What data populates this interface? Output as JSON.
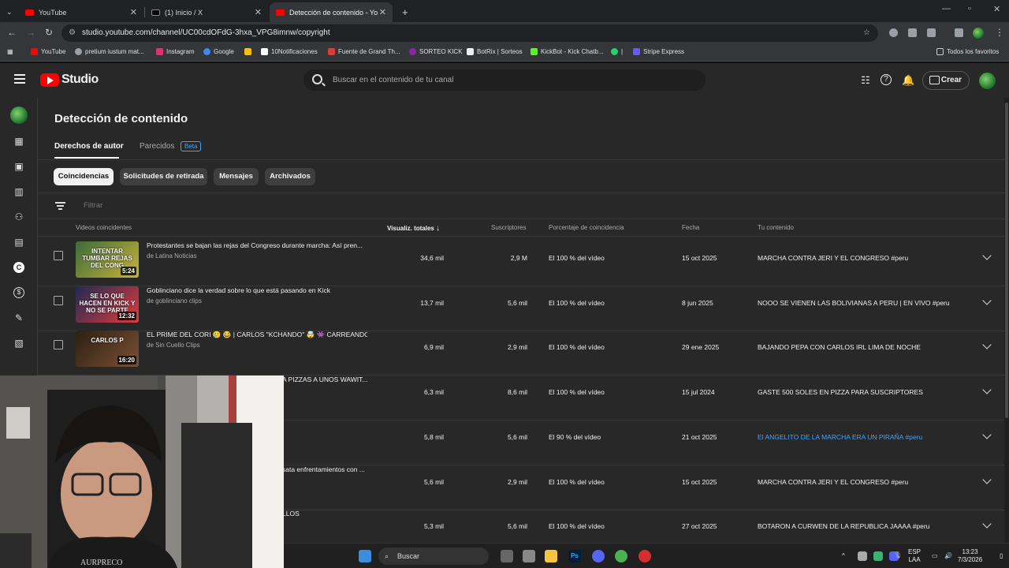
{
  "browser": {
    "tabs": [
      {
        "label": "YouTube"
      },
      {
        "label": "(1) Inicio / X"
      },
      {
        "label": "Detección de contenido - YouT"
      }
    ],
    "new_tab": "+",
    "url": "studio.youtube.com/channel/UC00cdOFdG-3hxa_VPG8imnw/copyright",
    "bookmarks": [
      {
        "label": "YouTube",
        "color": "#ff0000"
      },
      {
        "label": "pretium iustum mat...",
        "color": "#9aa0a6"
      },
      {
        "label": "Instagram",
        "color": "#e1306c"
      },
      {
        "label": "Google",
        "color": "#4285f4"
      },
      {
        "label": "",
        "color": "#fbbc04"
      },
      {
        "label": "10Notificaciones",
        "color": "#ffffff"
      },
      {
        "label": "Fuente de Grand Th...",
        "color": "#e53935"
      },
      {
        "label": "SORTEO KICK",
        "color": "#8e24aa"
      },
      {
        "label": "BotRix | Sorteos",
        "color": "#eeeeee"
      },
      {
        "label": "KickBot - Kick Chatb...",
        "color": "#53fc18"
      },
      {
        "label": "|",
        "color": "#25d366"
      },
      {
        "label": "Stripe Express",
        "color": "#635bff"
      }
    ],
    "all_bookmarks": "Todos los favoritos"
  },
  "studio": {
    "logo_text": "Studio",
    "search_placeholder": "Buscar en el contenido de tu canal",
    "create_label": "Crear"
  },
  "page": {
    "title": "Detección de contenido",
    "tabs": [
      {
        "label": "Derechos de autor"
      },
      {
        "label": "Parecidos"
      }
    ],
    "beta_badge": "Beta",
    "chips": [
      {
        "label": "Coincidencias"
      },
      {
        "label": "Solicitudes de retirada"
      },
      {
        "label": "Mensajes"
      },
      {
        "label": "Archivados"
      }
    ],
    "filter_placeholder": "Filtrar",
    "columns": {
      "videos": "Videos coincidentes",
      "views": "Visualiz. totales",
      "subs": "Suscriptores",
      "percent": "Porcentaje de coincidencia",
      "date": "Fecha",
      "content": "Tu contenido"
    },
    "rows": [
      {
        "title": "Protestantes se bajan las rejas del Congreso durante marcha: Así pren...",
        "channel": "de Latina Noticias",
        "thumb_caption": "INTENTAR TUMBAR REJAS DEL CONG",
        "duration": "5:24",
        "views": "34,6 mil",
        "subs": "2,9 M",
        "percent": "El 100 % del vídeo",
        "date": "15 oct 2025",
        "content": "MARCHA CONTRA JERI Y EL CONGRESO #peru",
        "link": false
      },
      {
        "title": "Goblinciano dice la verdad sobre lo que está pasando en Kick",
        "channel": "de goblinciano clips",
        "thumb_caption": "SE LO QUE HACEN EN KICK Y NO SE PARTE",
        "duration": "12:32",
        "views": "13,7 mil",
        "subs": "5,6 mil",
        "percent": "El 100 % del vídeo",
        "date": "8 jun 2025",
        "content": "NOOO SE VIENEN LAS BOLIVIANAS A PERU | EN VIVO #peru",
        "link": false
      },
      {
        "title": "EL PRIME DEL CORI 🥲 😂 | CARLOS \"KCHANDO\" 🤯 👾 CARREANDO E...",
        "channel": "de Sin Cuello Clips",
        "thumb_caption": "CARLOS P",
        "duration": "16:20",
        "views": "6,9 mil",
        "subs": "2,9 mil",
        "percent": "El 100 % del vídeo",
        "date": "29 ene 2025",
        "content": "BAJANDO PEPA CON CARLOS IRL LIMA DE NOCHE",
        "link": false
      },
      {
        "title": "A PIZZAS A UNOS WAWIT...",
        "channel": "",
        "thumb_caption": "",
        "duration": "",
        "views": "6,3 mil",
        "subs": "8,6 mil",
        "percent": "El 100 % del vídeo",
        "date": "15 jul 2024",
        "content": "GASTE 500 SOLES EN PIZZA PARA SUSCRIPTORES",
        "link": false
      },
      {
        "title": "",
        "channel": "",
        "thumb_caption": "",
        "duration": "",
        "views": "5,8 mil",
        "subs": "5,6 mil",
        "percent": "El 90 % del vídeo",
        "date": "21 oct 2025",
        "content": "El ANGELITO DE LA MARCHA ERA UN PIRAÑA #peru",
        "link": true
      },
      {
        "title": "sata enfrentamientos con ...",
        "channel": "",
        "thumb_caption": "",
        "duration": "",
        "views": "5,6 mil",
        "subs": "2,9 mil",
        "percent": "El 100 % del vídeo",
        "date": "15 oct 2025",
        "content": "MARCHA CONTRA JERI Y EL CONGRESO #peru",
        "link": false
      },
      {
        "title": "LLOS",
        "channel": "",
        "thumb_caption": "",
        "duration": "",
        "views": "5,3 mil",
        "subs": "5,6 mil",
        "percent": "El 100 % del vídeo",
        "date": "27 oct 2025",
        "content": "BOTARON A CURWEN DE LA REPUBLICA JAAAA #peru",
        "link": false
      }
    ]
  },
  "taskbar": {
    "search_label": "Buscar",
    "lang_top": "ESP",
    "lang_bottom": "LAA",
    "time": "13:23",
    "date": "7/3/2026"
  },
  "webcam": {
    "shirt_text": "AURPRECO"
  },
  "colors": {
    "accent_link": "#3ea6ff",
    "brand_red": "#ff0000",
    "bg": "#282828"
  }
}
